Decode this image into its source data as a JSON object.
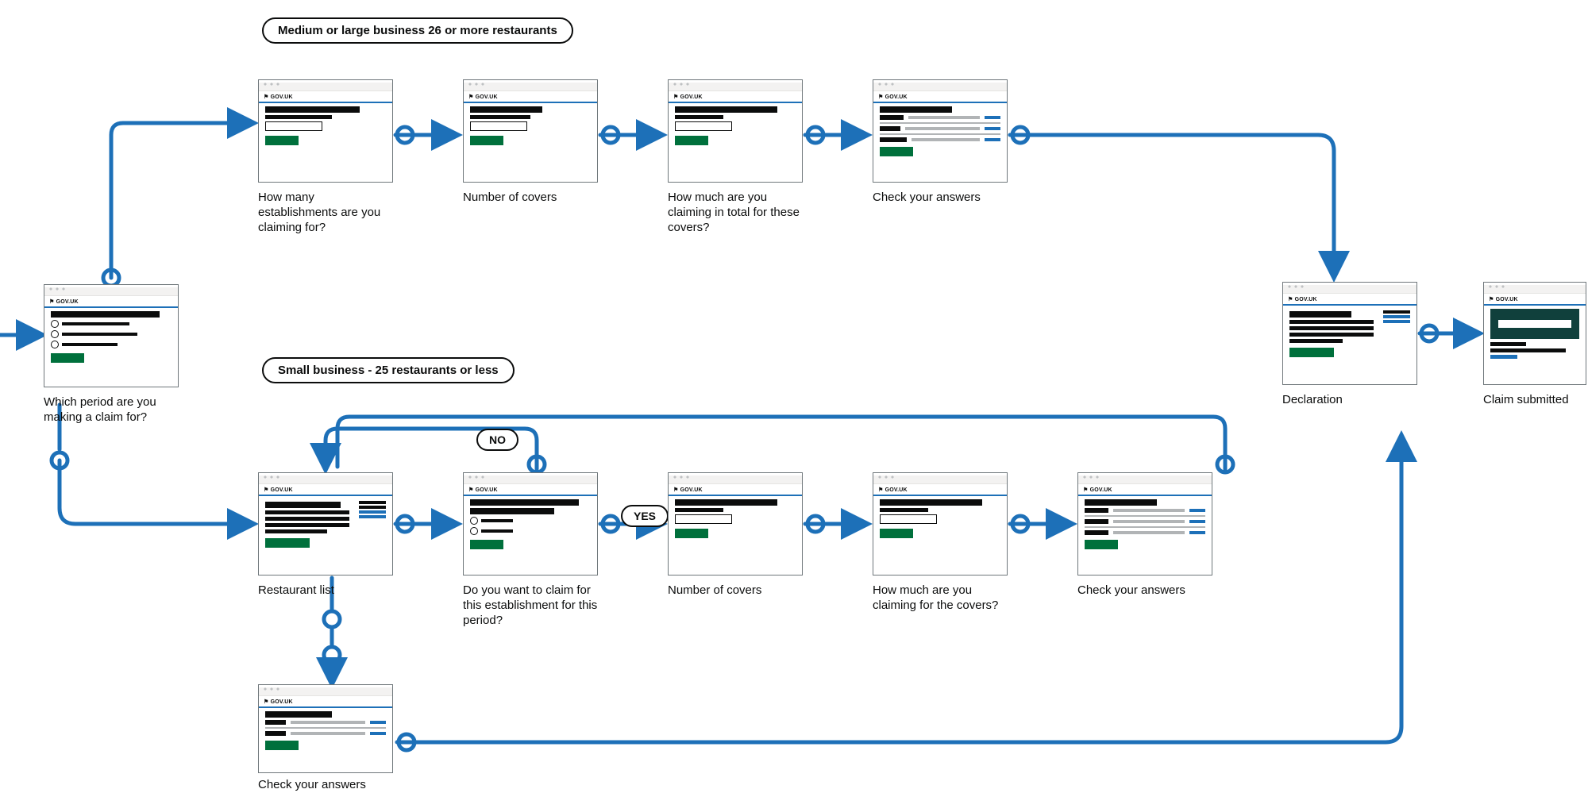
{
  "govuk_label": "⚑ GOV.UK",
  "branches": {
    "large": "Medium or large business 26 or more restaurants",
    "small": "Small business - 25 restaurants or less"
  },
  "decisions": {
    "yes": "YES",
    "no": "NO"
  },
  "nodes": {
    "start": {
      "caption": "Which period are you making a claim for?"
    },
    "l1": {
      "caption": "How many establishments are you claiming for?"
    },
    "l2": {
      "caption": "Number of covers"
    },
    "l3": {
      "caption": "How much are you claiming in total for these covers?"
    },
    "l4": {
      "caption": "Check your answers"
    },
    "s1": {
      "caption": "Restaurant list"
    },
    "s2": {
      "caption": "Do you want to claim for this establishment for this period?"
    },
    "s3": {
      "caption": "Number of covers"
    },
    "s4": {
      "caption": "How much are you claiming for the covers?"
    },
    "s5": {
      "caption": "Check your answers"
    },
    "s6": {
      "caption": "Check your answers"
    },
    "declaration": {
      "caption": "Declaration"
    },
    "submitted": {
      "caption": "Claim submitted"
    }
  }
}
